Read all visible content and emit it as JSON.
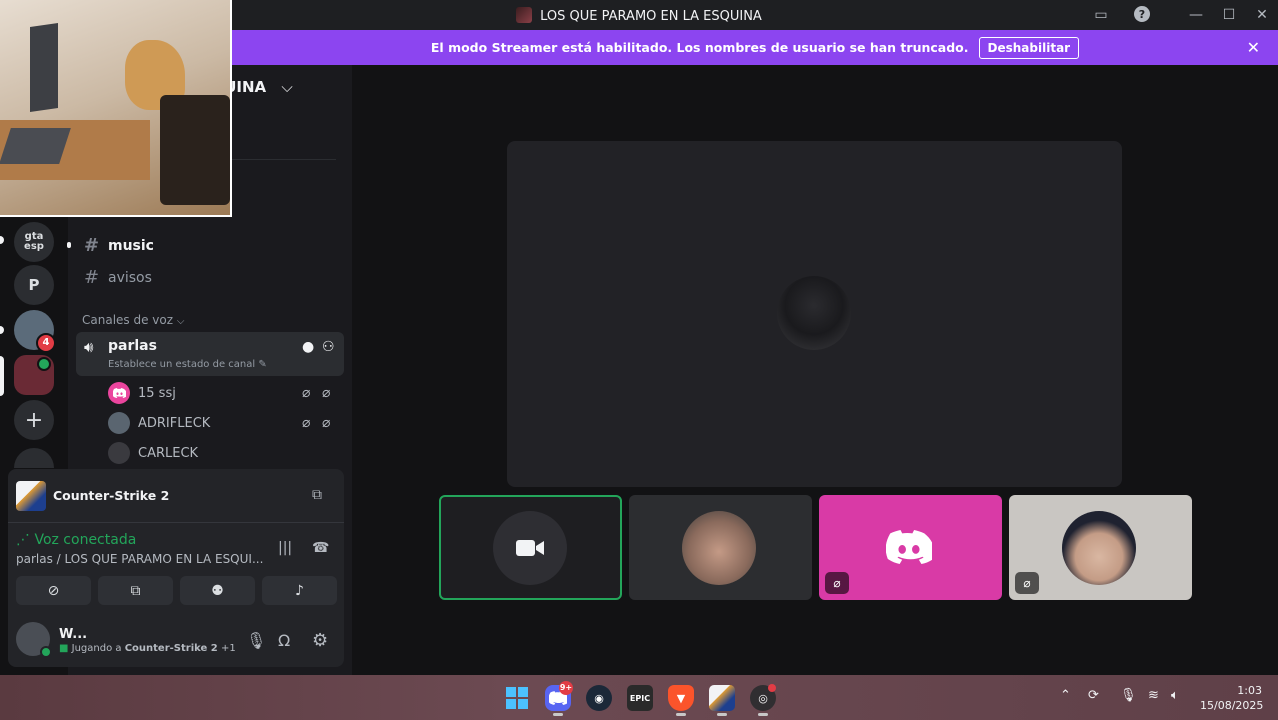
{
  "window": {
    "title": "LOS QUE PARAMO EN LA ESQUINA"
  },
  "banner": {
    "message": "El modo Streamer está habilitado. Los nombres de usuario se han truncado.",
    "button": "Deshabilitar"
  },
  "server": {
    "name": "LA ESQUINA"
  },
  "rail": {
    "servers": [
      {
        "label": "gta esp",
        "color": "#2b2d31"
      },
      {
        "label": "P",
        "color": "#2b2d31"
      },
      {
        "label": "",
        "color": "#5b6b7a",
        "badge": "4"
      },
      {
        "label": "",
        "color": "#6a2a35"
      }
    ]
  },
  "channels": {
    "text": [
      "music",
      "avisos"
    ],
    "voice_category": "Canales de voz",
    "voice_channel": {
      "name": "parlas",
      "status": "Establece un estado de canal"
    },
    "voice_users": [
      {
        "name": "15 ssj",
        "color": "#eb459e"
      },
      {
        "name": "ADRIFLECK",
        "color": "#5a6570"
      },
      {
        "name": "CARLECK",
        "color": "#3a3a3f"
      }
    ]
  },
  "activity": {
    "game": "Counter-Strike 2"
  },
  "voice": {
    "status": "Voz conectada",
    "location": "parlas / LOS QUE PARAMO EN LA ESQUI..."
  },
  "user": {
    "name": "W...",
    "activity_prefix": "Jugando a",
    "activity_game": "Counter-Strike 2",
    "activity_extra": "+1"
  },
  "taskbar": {
    "discord_badge": "9+",
    "epic_label": "EPIC",
    "time": "1:03",
    "date": "15/08/2025"
  },
  "colors": {
    "accent": "#8c45f0",
    "voice_green": "#23a55a",
    "discord_pink": "#d93aa6",
    "notification_red": "#e23c45"
  }
}
